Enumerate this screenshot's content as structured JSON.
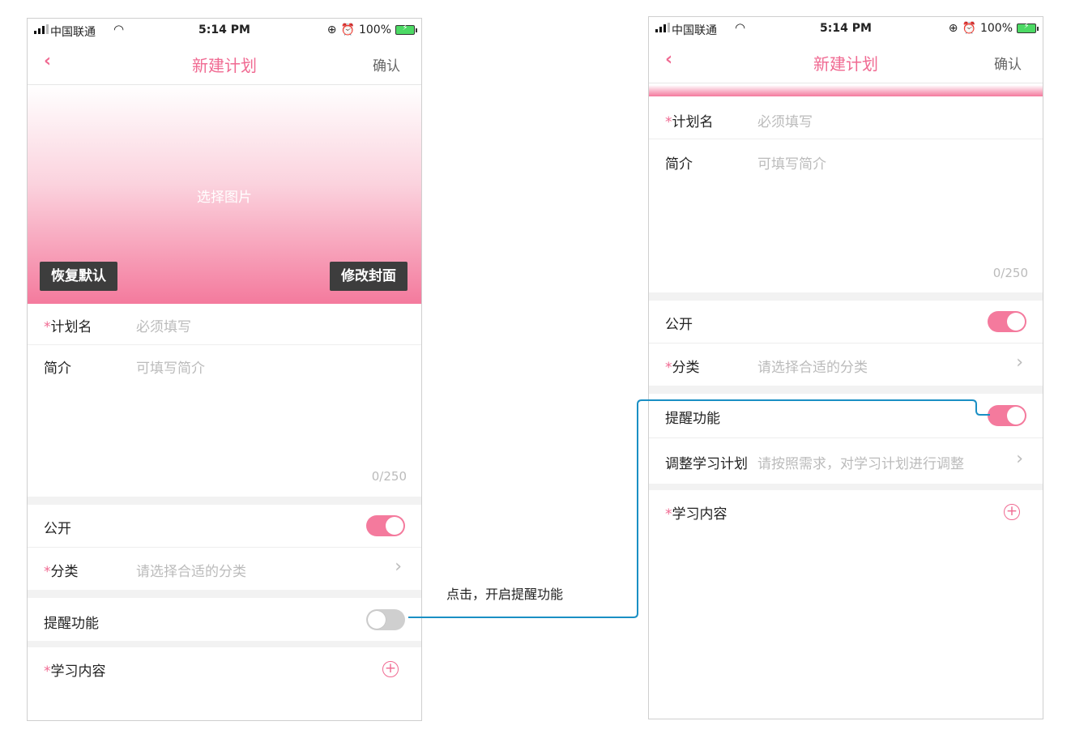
{
  "status_bar": {
    "carrier": "中国联通",
    "time": "5:14 PM",
    "battery": "100%"
  },
  "nav": {
    "back_icon": "‹",
    "title": "新建计划",
    "confirm": "确认"
  },
  "cover": {
    "pick_label": "选择图片",
    "restore_label": "恢复默认",
    "change_label": "修改封面"
  },
  "form": {
    "name_label": "计划名",
    "name_placeholder": "必须填写",
    "intro_label": "简介",
    "intro_placeholder": "可填写简介",
    "intro_count": "0/250",
    "public_label": "公开",
    "category_label": "分类",
    "category_placeholder": "请选择合适的分类",
    "reminder_label": "提醒功能",
    "adjust_label": "调整学习计划",
    "adjust_placeholder": "请按照需求，对学习计划进行调整",
    "content_label": "学习内容",
    "required_mark": "*"
  },
  "states": {
    "left_public": "on",
    "left_reminder": "off",
    "right_public": "on",
    "right_reminder": "on"
  },
  "annotation": "点击，开启提醒功能",
  "colors": {
    "accent": "#f06a92",
    "toggle_on": "#f47a9d",
    "connector": "#1a8fc4"
  }
}
